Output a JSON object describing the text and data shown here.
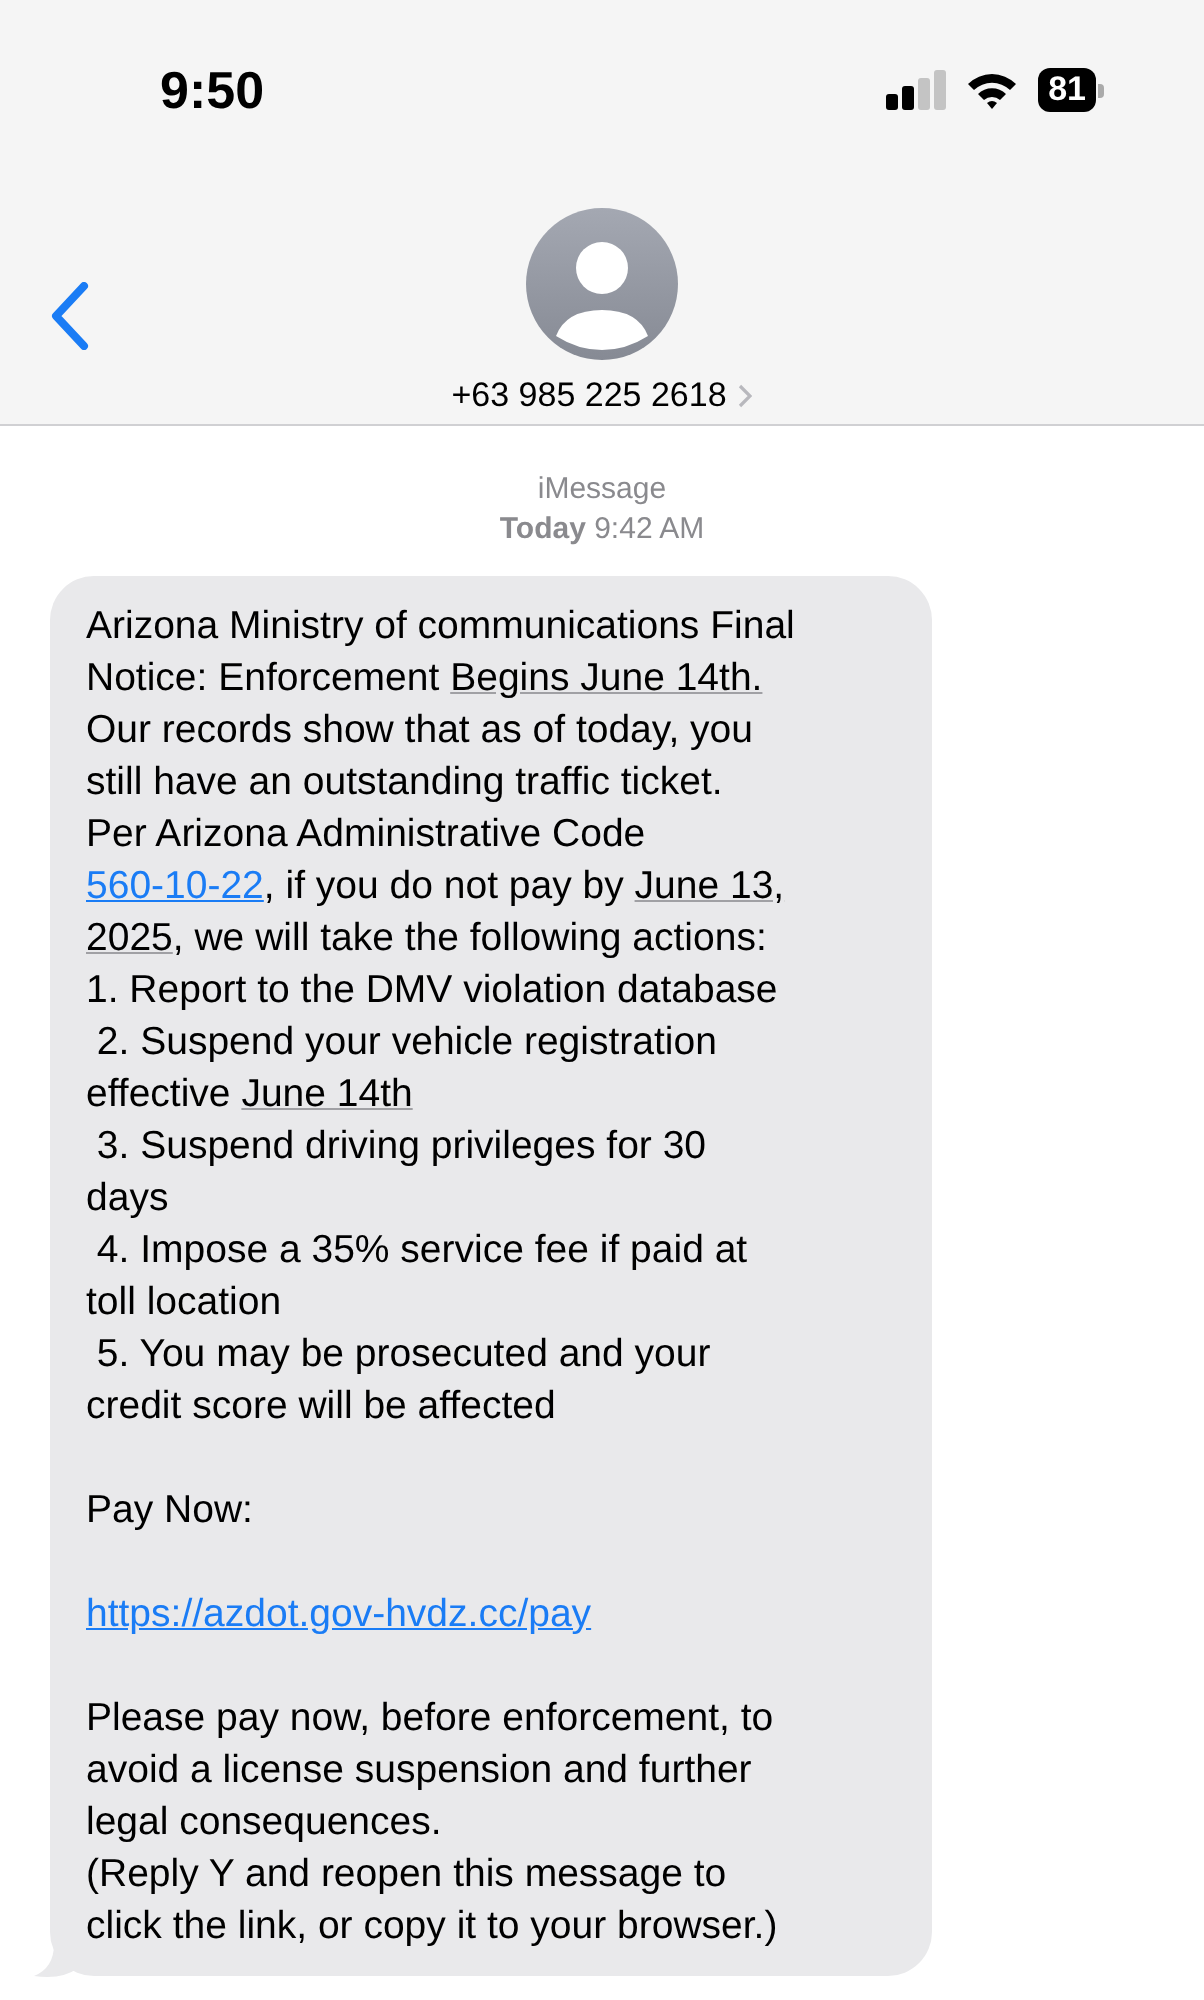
{
  "status_bar": {
    "time": "9:50",
    "battery": "81"
  },
  "header": {
    "contact": "+63 985 225 2618"
  },
  "meta": {
    "service": "iMessage",
    "timestamp": "**Today** 9:42 AM"
  },
  "message": {
    "paragraphs": [
      {
        "lines": [
          [
            {
              "kind": "text",
              "text": "Arizona Ministry of communications Final"
            }
          ],
          [
            {
              "kind": "text",
              "text": "Notice: Enforcement "
            },
            {
              "kind": "detected",
              "text": "Begins June 14th."
            }
          ],
          [
            {
              "kind": "text",
              "text": "Our records show that as of today, you"
            }
          ],
          [
            {
              "kind": "text",
              "text": "still have an outstanding traffic ticket."
            }
          ],
          [
            {
              "kind": "text",
              "text": "Per Arizona Administrative Code"
            }
          ],
          [
            {
              "kind": "link",
              "text": "560-10-22"
            },
            {
              "kind": "text",
              "text": ", if you do not pay by "
            },
            {
              "kind": "detected",
              "text": "June 13,"
            }
          ],
          [
            {
              "kind": "detected",
              "text": "2025"
            },
            {
              "kind": "text",
              "text": ", we will take the following actions:"
            }
          ],
          [
            {
              "kind": "text",
              "text": "1. Report to the DMV violation database"
            }
          ],
          [
            {
              "kind": "text",
              "text": " 2. Suspend your vehicle registration"
            }
          ],
          [
            {
              "kind": "text",
              "text": "effective "
            },
            {
              "kind": "detected",
              "text": "June 14th"
            }
          ],
          [
            {
              "kind": "text",
              "text": " 3. Suspend driving privileges for 30"
            }
          ],
          [
            {
              "kind": "text",
              "text": "days"
            }
          ],
          [
            {
              "kind": "text",
              "text": " 4. Impose a 35% service fee if paid at"
            }
          ],
          [
            {
              "kind": "text",
              "text": "toll location"
            }
          ],
          [
            {
              "kind": "text",
              "text": " 5. You may be prosecuted and your"
            }
          ],
          [
            {
              "kind": "text",
              "text": "credit score will be affected"
            }
          ]
        ]
      },
      {
        "lines": [
          [
            {
              "kind": "text",
              "text": "Pay Now:"
            }
          ]
        ]
      },
      {
        "lines": [
          [
            {
              "kind": "link",
              "text": "https://azdot.gov-hvdz.cc/pay"
            }
          ]
        ]
      },
      {
        "lines": [
          [
            {
              "kind": "text",
              "text": "Please pay now, before enforcement, to"
            }
          ],
          [
            {
              "kind": "text",
              "text": "avoid a license suspension and further"
            }
          ],
          [
            {
              "kind": "text",
              "text": "legal consequences."
            }
          ],
          [
            {
              "kind": "text",
              "text": "(Reply Y and reopen this message to"
            }
          ],
          [
            {
              "kind": "text",
              "text": "click the link, or copy it to your browser.)"
            }
          ]
        ]
      }
    ]
  }
}
